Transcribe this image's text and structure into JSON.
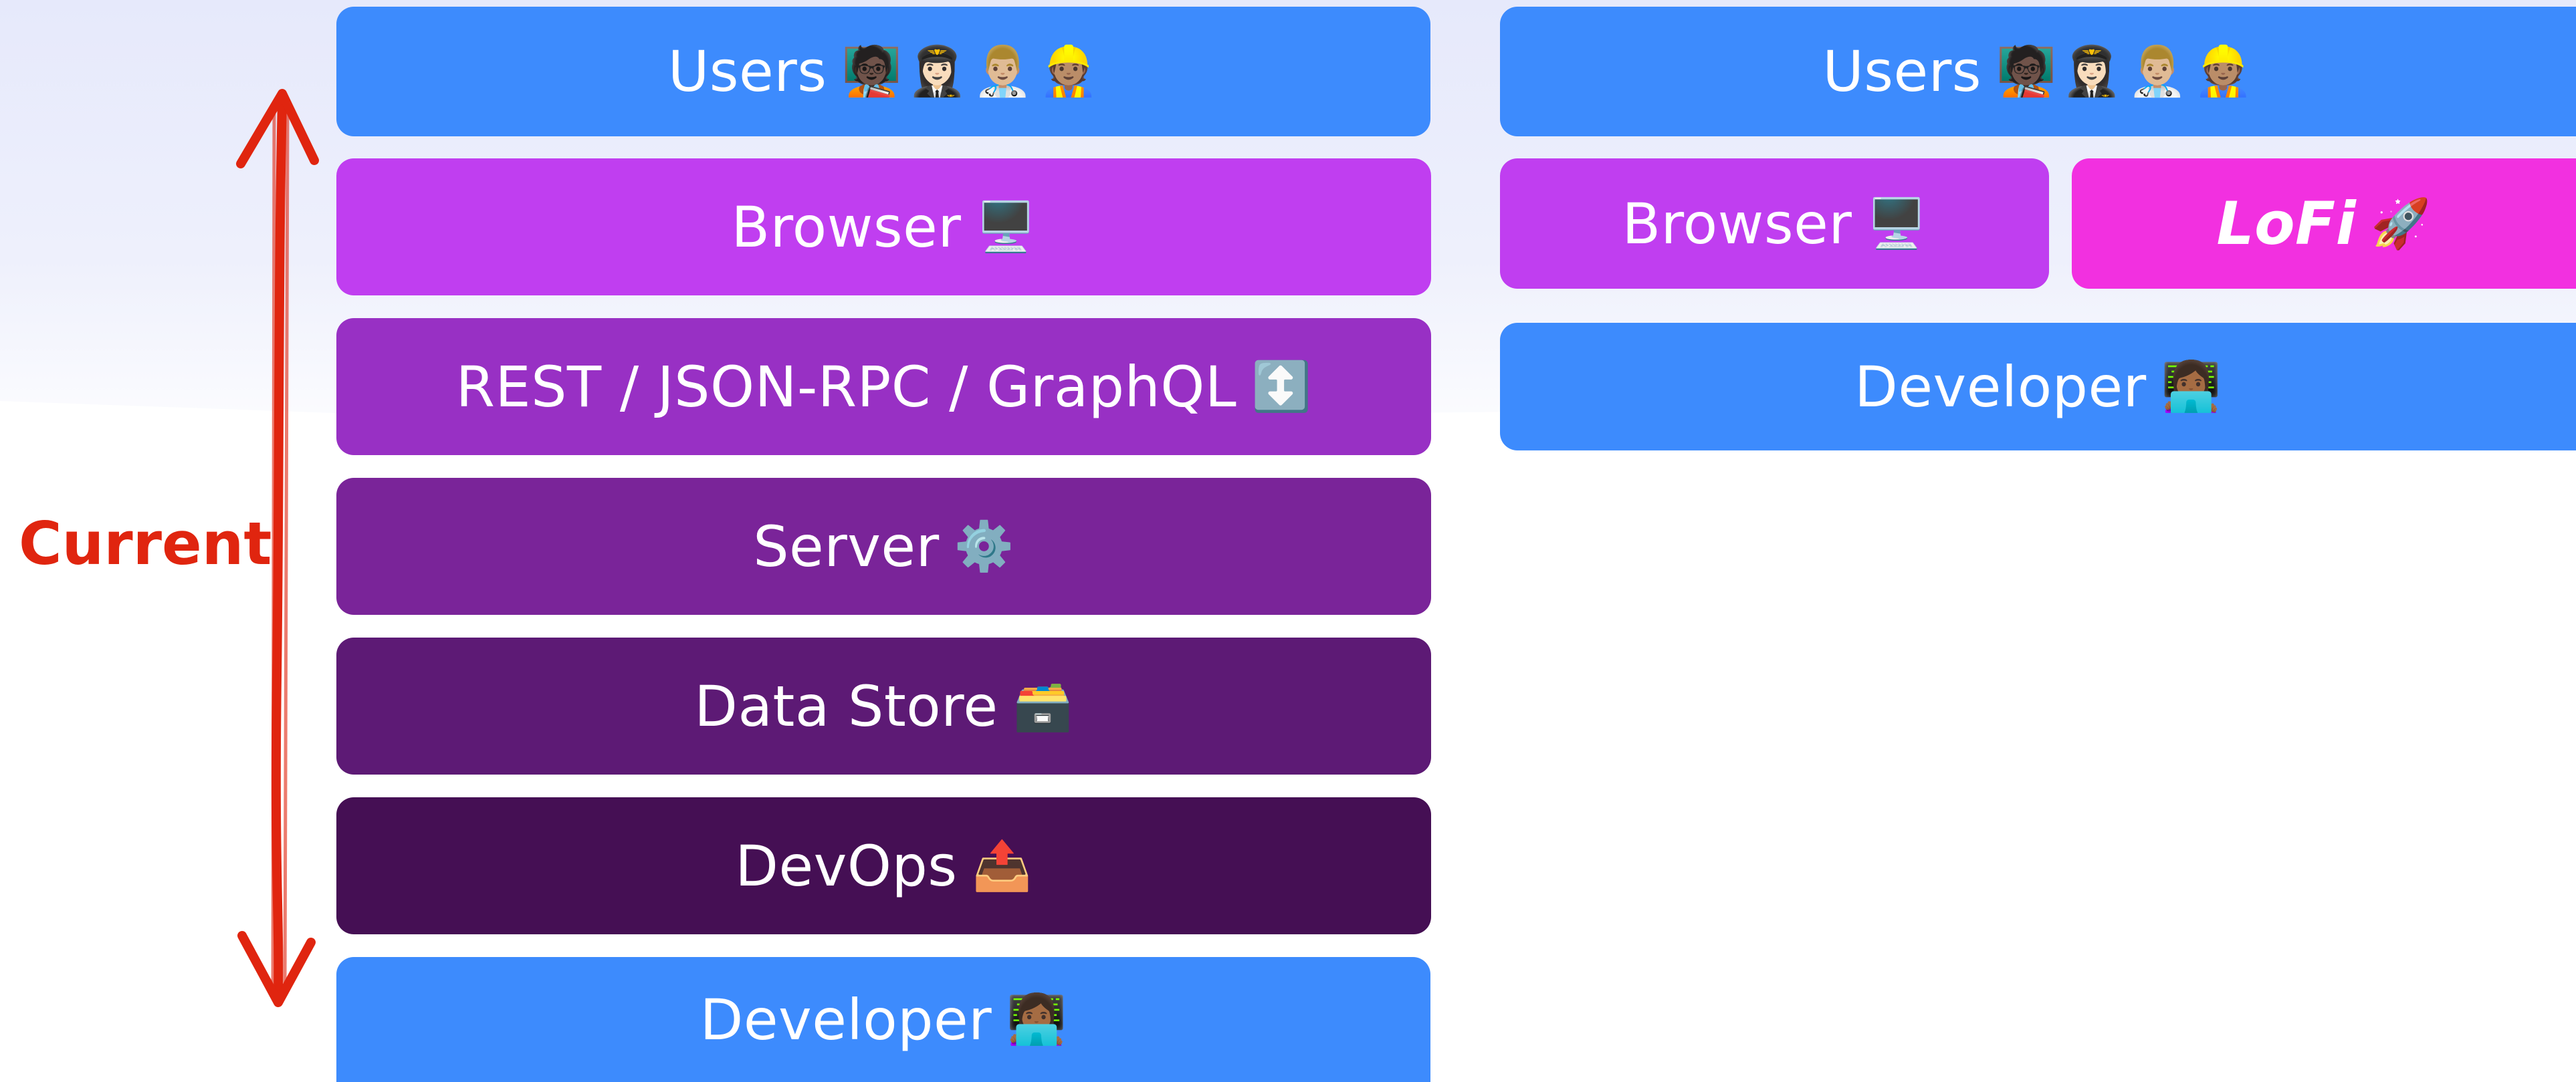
{
  "left_stack": {
    "users": {
      "label": "Users",
      "emoji": [
        "🧑🏿‍🏫",
        "👩🏻‍✈️",
        "👨🏼‍⚕️",
        "👷🏽"
      ]
    },
    "browser": {
      "label": "Browser",
      "emoji": [
        "🖥️"
      ]
    },
    "api": {
      "label": "REST / JSON-RPC / GraphQL",
      "emoji": [
        "↕️"
      ]
    },
    "server": {
      "label": "Server",
      "emoji": [
        "⚙️"
      ]
    },
    "datastore": {
      "label": "Data Store",
      "emoji": [
        "🗃️"
      ]
    },
    "devops": {
      "label": "DevOps",
      "emoji": [
        "📤"
      ]
    },
    "developer": {
      "label": "Developer",
      "emoji": [
        "👩🏾‍💻"
      ]
    }
  },
  "right_stack": {
    "users": {
      "label": "Users",
      "emoji": [
        "🧑🏿‍🏫",
        "👩🏻‍✈️",
        "👨🏼‍⚕️",
        "👷🏽"
      ]
    },
    "browser": {
      "label": "Browser",
      "emoji": [
        "🖥️"
      ]
    },
    "lofi": {
      "label": "LoFi",
      "emoji": [
        "🚀"
      ]
    },
    "developer": {
      "label": "Developer",
      "emoji": [
        "👩🏾‍💻"
      ]
    }
  },
  "annotation": {
    "label": "Current",
    "arrow_color": "#e0250f"
  },
  "colors": {
    "blue": "#3d8bfd",
    "browser_purple": "#c03ef0",
    "api_purple": "#9830c4",
    "server_purple": "#7a2499",
    "datastore_purple": "#5d1a75",
    "devops_purple": "#450f54",
    "lofi_magenta": "#f230e0"
  }
}
